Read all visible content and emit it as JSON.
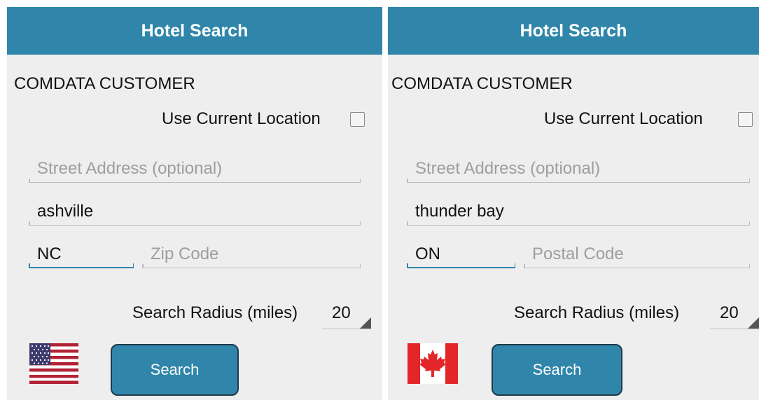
{
  "colors": {
    "header": "#2f86aa",
    "accent": "#2f86aa",
    "background": "#eeeeee"
  },
  "screens": [
    {
      "title": "Hotel Search",
      "customer": "COMDATA CUSTOMER",
      "use_location_label": "Use Current Location",
      "use_location_checked": false,
      "street_placeholder": "Street Address (optional)",
      "street_value": "",
      "city_value": "ashville",
      "state_value": "NC",
      "zip_placeholder": "Zip Code",
      "radius_label": "Search Radius (miles)",
      "radius_value": "20",
      "search_label": "Search",
      "flag_icon": "usa-flag-icon"
    },
    {
      "title": "Hotel Search",
      "customer": "COMDATA CUSTOMER",
      "use_location_label": "Use Current Location",
      "use_location_checked": false,
      "street_placeholder": "Street Address (optional)",
      "street_value": "",
      "city_value": "thunder bay",
      "state_value": "ON",
      "zip_placeholder": "Postal Code",
      "radius_label": "Search Radius (miles)",
      "radius_value": "20",
      "search_label": "Search",
      "flag_icon": "canada-flag-icon"
    }
  ]
}
